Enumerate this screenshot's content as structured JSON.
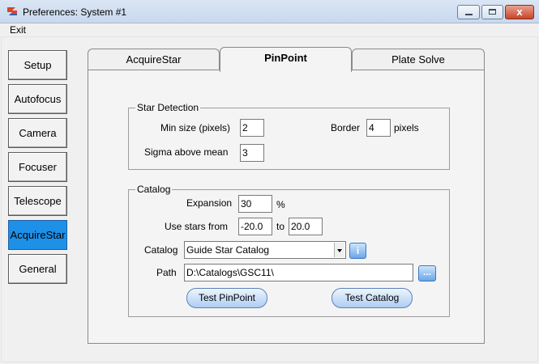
{
  "window": {
    "title": "Preferences: System #1",
    "close_label": "x"
  },
  "menu": {
    "exit": "Exit"
  },
  "sidebar": {
    "items": [
      {
        "label": "Setup"
      },
      {
        "label": "Autofocus"
      },
      {
        "label": "Camera"
      },
      {
        "label": "Focuser"
      },
      {
        "label": "Telescope"
      },
      {
        "label": "AcquireStar",
        "active": true
      },
      {
        "label": "General"
      }
    ]
  },
  "tabs": [
    {
      "label": "AcquireStar"
    },
    {
      "label": "PinPoint",
      "active": true
    },
    {
      "label": "Plate Solve"
    }
  ],
  "star_detection": {
    "title": "Star Detection",
    "min_size_label": "Min size (pixels)",
    "min_size_value": "2",
    "border_label": "Border",
    "border_value": "4",
    "border_unit": "pixels",
    "sigma_label": "Sigma above mean",
    "sigma_value": "3"
  },
  "catalog": {
    "title": "Catalog",
    "expansion_label": "Expansion",
    "expansion_value": "30",
    "expansion_unit": "%",
    "use_stars_label": "Use stars from",
    "from_value": "-20.0",
    "to_label": "to",
    "to_value": "20.0",
    "catalog_label": "Catalog",
    "catalog_value": "Guide Star Catalog",
    "info_label": "i",
    "path_label": "Path",
    "path_value": "D:\\Catalogs\\GSC11\\",
    "browse_label": "...",
    "test_pinpoint": "Test PinPoint",
    "test_catalog": "Test Catalog"
  },
  "colors": {
    "active_side": "#1e90e8",
    "button_blue": "#6aa6e8"
  }
}
